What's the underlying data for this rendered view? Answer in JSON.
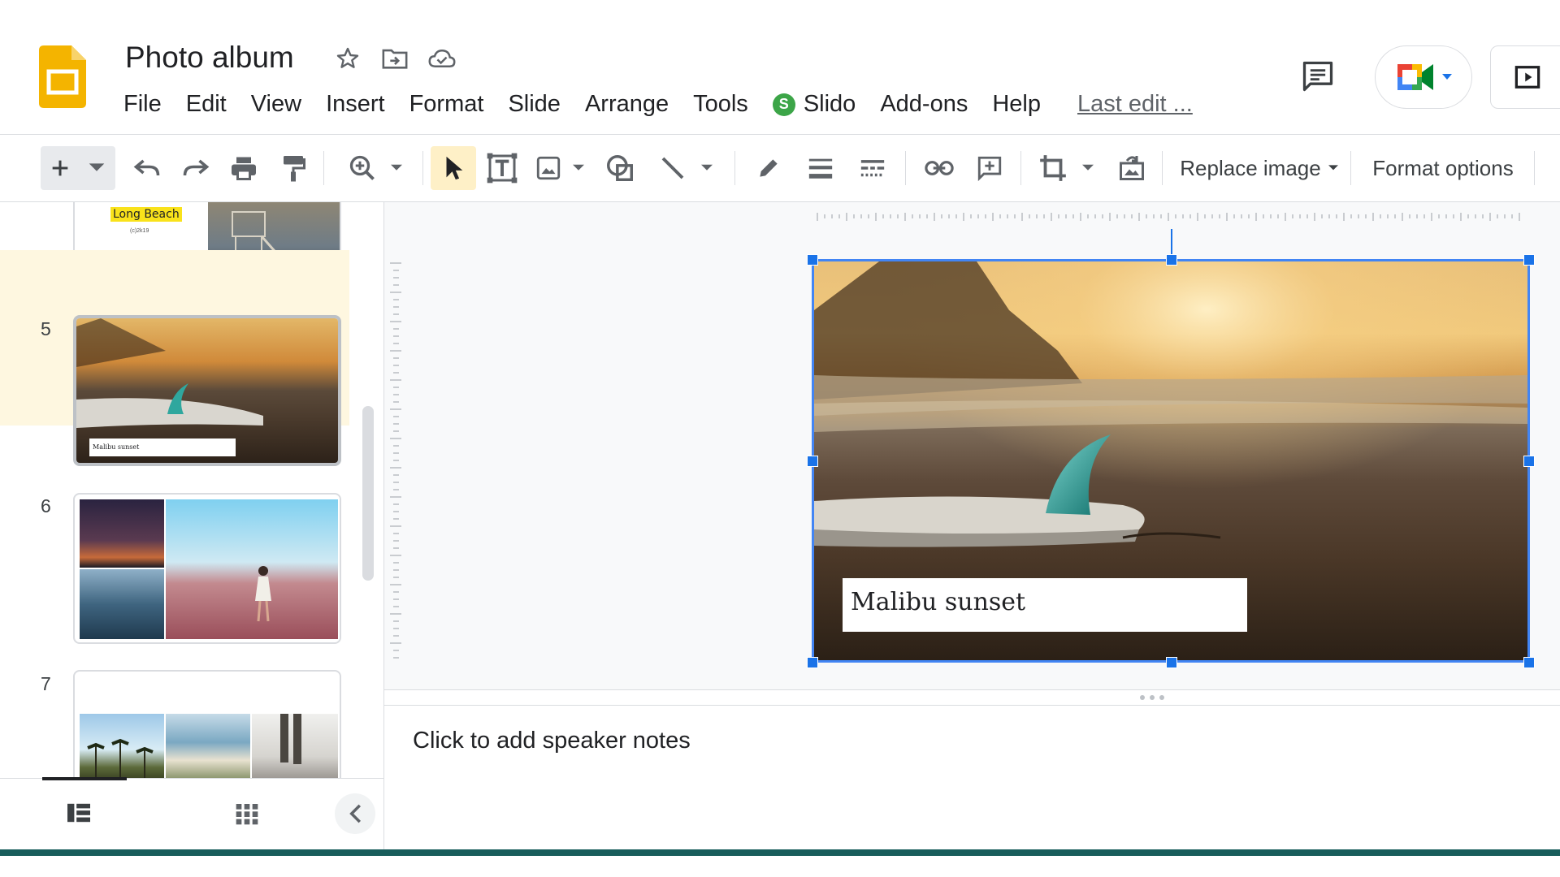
{
  "app": {
    "doc_title": "Photo album",
    "icons": [
      "star-icon",
      "move-to-folder-icon",
      "cloud-saved-icon"
    ],
    "brand_color": "#f4b400",
    "accent_color": "#1a73e8"
  },
  "menu": {
    "items": [
      "File",
      "Edit",
      "View",
      "Insert",
      "Format",
      "Slide",
      "Arrange",
      "Tools"
    ],
    "slido": {
      "badge": "S",
      "label": "Slido"
    },
    "items_after": [
      "Add-ons",
      "Help"
    ],
    "last_edit": "Last edit ..."
  },
  "toolbar": {
    "replace_image": "Replace image",
    "format_options": "Format options"
  },
  "filmstrip": {
    "slides": [
      {
        "number": "",
        "title": "Long Beach",
        "subtitle": "(c)2k19"
      },
      {
        "number": "5",
        "caption": "Malibu sunset",
        "selected": true
      },
      {
        "number": "6"
      },
      {
        "number": "7"
      }
    ]
  },
  "slide": {
    "caption": "Malibu sunset"
  },
  "notes": {
    "placeholder": "Click to add speaker notes"
  }
}
